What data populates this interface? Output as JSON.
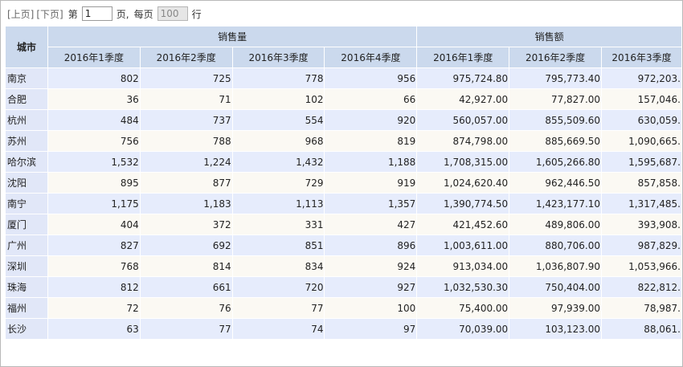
{
  "pager": {
    "prev_label": "[上页]",
    "next_label": "[下页]",
    "page_prefix": "第",
    "page_value": "1",
    "page_suffix": "页,",
    "per_page_prefix": "每页",
    "per_page_value": "100",
    "per_page_suffix": "行"
  },
  "table": {
    "city_header": "城市",
    "groups": [
      "销售量",
      "销售额"
    ],
    "quarters": [
      "2016年1季度",
      "2016年2季度",
      "2016年3季度",
      "2016年4季度",
      "2016年1季度",
      "2016年2季度",
      "2016年3季度"
    ],
    "rows": [
      {
        "city": "南京",
        "values": [
          "802",
          "725",
          "778",
          "956",
          "975,724.80",
          "795,773.40",
          "972,203."
        ]
      },
      {
        "city": "合肥",
        "values": [
          "36",
          "71",
          "102",
          "66",
          "42,927.00",
          "77,827.00",
          "157,046."
        ]
      },
      {
        "city": "杭州",
        "values": [
          "484",
          "737",
          "554",
          "920",
          "560,057.00",
          "855,509.60",
          "630,059."
        ]
      },
      {
        "city": "苏州",
        "values": [
          "756",
          "788",
          "968",
          "819",
          "874,798.00",
          "885,669.50",
          "1,090,665."
        ]
      },
      {
        "city": "哈尔滨",
        "values": [
          "1,532",
          "1,224",
          "1,432",
          "1,188",
          "1,708,315.00",
          "1,605,266.80",
          "1,595,687."
        ]
      },
      {
        "city": "沈阳",
        "values": [
          "895",
          "877",
          "729",
          "919",
          "1,024,620.40",
          "962,446.50",
          "857,858."
        ]
      },
      {
        "city": "南宁",
        "values": [
          "1,175",
          "1,183",
          "1,113",
          "1,357",
          "1,390,774.50",
          "1,423,177.10",
          "1,317,485."
        ]
      },
      {
        "city": "厦门",
        "values": [
          "404",
          "372",
          "331",
          "427",
          "421,452.60",
          "489,806.00",
          "393,908."
        ]
      },
      {
        "city": "广州",
        "values": [
          "827",
          "692",
          "851",
          "896",
          "1,003,611.00",
          "880,706.00",
          "987,829."
        ]
      },
      {
        "city": "深圳",
        "values": [
          "768",
          "814",
          "834",
          "924",
          "913,034.00",
          "1,036,807.90",
          "1,053,966."
        ]
      },
      {
        "city": "珠海",
        "values": [
          "812",
          "661",
          "720",
          "927",
          "1,032,530.30",
          "750,404.00",
          "822,812."
        ]
      },
      {
        "city": "福州",
        "values": [
          "72",
          "76",
          "77",
          "100",
          "75,400.00",
          "97,939.00",
          "78,987."
        ]
      },
      {
        "city": "长沙",
        "values": [
          "63",
          "77",
          "74",
          "97",
          "70,039.00",
          "103,123.00",
          "88,061."
        ]
      }
    ]
  }
}
